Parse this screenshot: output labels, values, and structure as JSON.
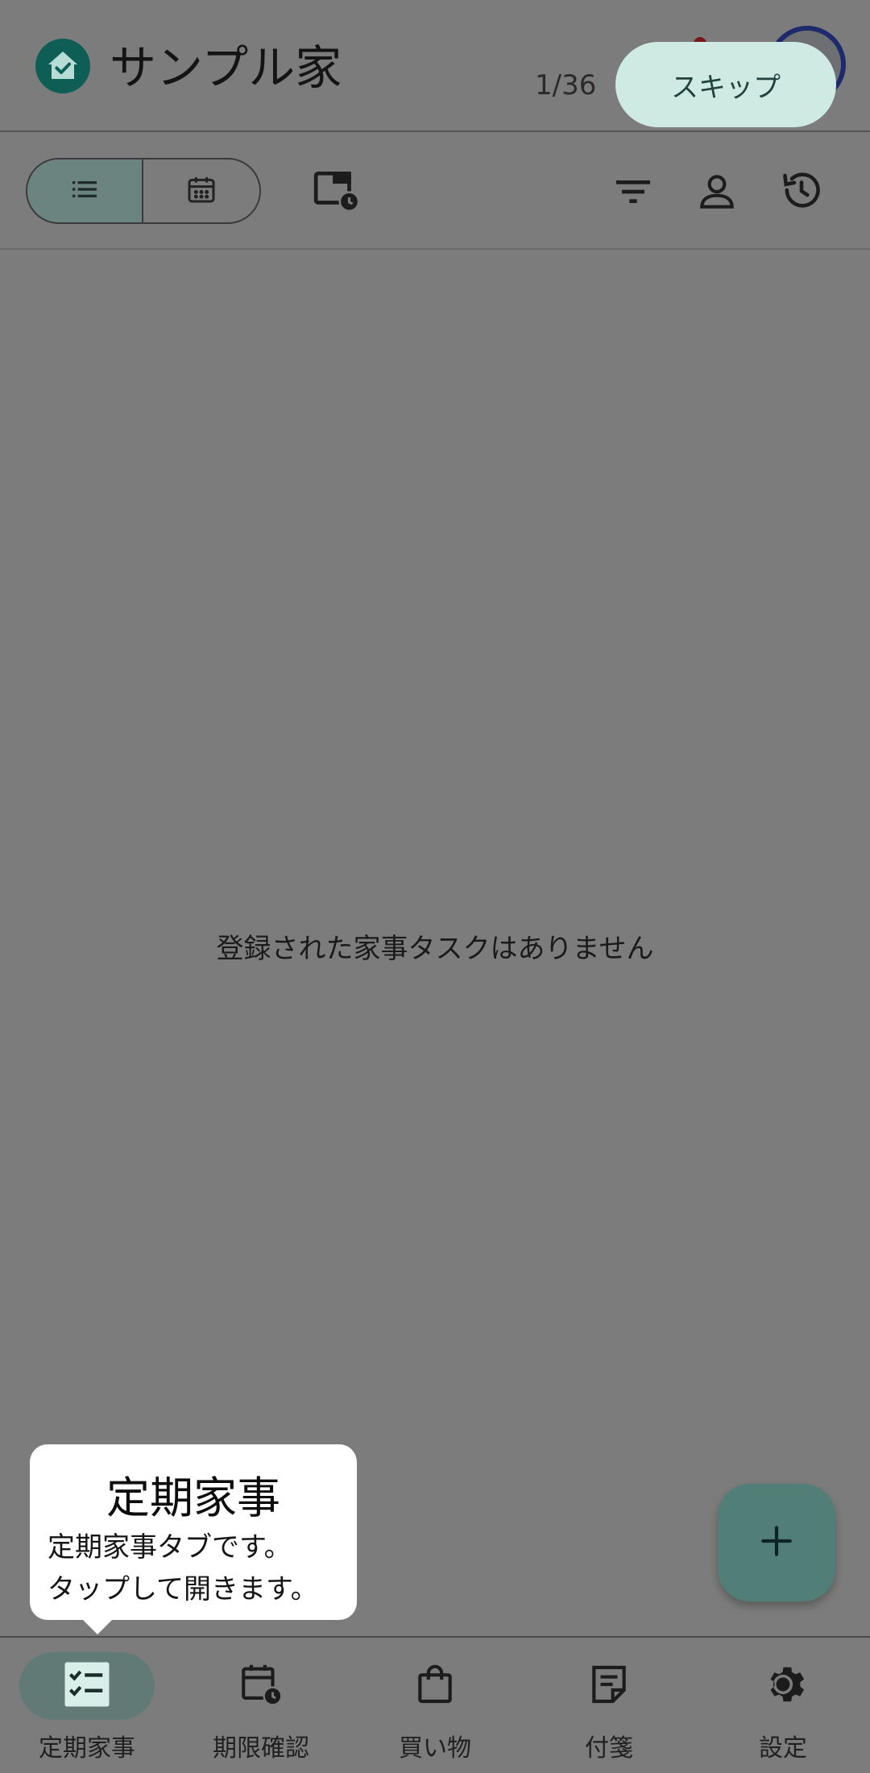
{
  "header": {
    "title": "サンプル家",
    "logo_icon": "home-check-icon",
    "step_counter": "1/36",
    "skip_label": "スキップ"
  },
  "toolbar": {
    "view_toggle": [
      {
        "icon": "list-icon",
        "selected": true
      },
      {
        "icon": "calendar-icon",
        "selected": false
      }
    ],
    "icons": [
      "calendar-clock-icon",
      "filter-icon",
      "person-icon",
      "history-icon"
    ]
  },
  "main": {
    "empty_message": "登録された家事タスクはありません",
    "fab_icon": "plus-icon"
  },
  "tooltip": {
    "title": "定期家事",
    "line1": "定期家事タブです。",
    "line2": "タップして開きます。"
  },
  "bottom_nav": {
    "items": [
      {
        "label": "定期家事",
        "icon": "checklist-icon",
        "active": true
      },
      {
        "label": "期限確認",
        "icon": "calendar-clock-icon",
        "active": false
      },
      {
        "label": "買い物",
        "icon": "shopping-bag-icon",
        "active": false
      },
      {
        "label": "付箋",
        "icon": "sticky-note-icon",
        "active": false
      },
      {
        "label": "設定",
        "icon": "gear-icon",
        "active": false
      }
    ]
  },
  "colors": {
    "scrim": "#7b7c7b",
    "accent": "#0f5e55",
    "skip_bg": "#cfe9e3",
    "fab_bg": "#527e78"
  }
}
